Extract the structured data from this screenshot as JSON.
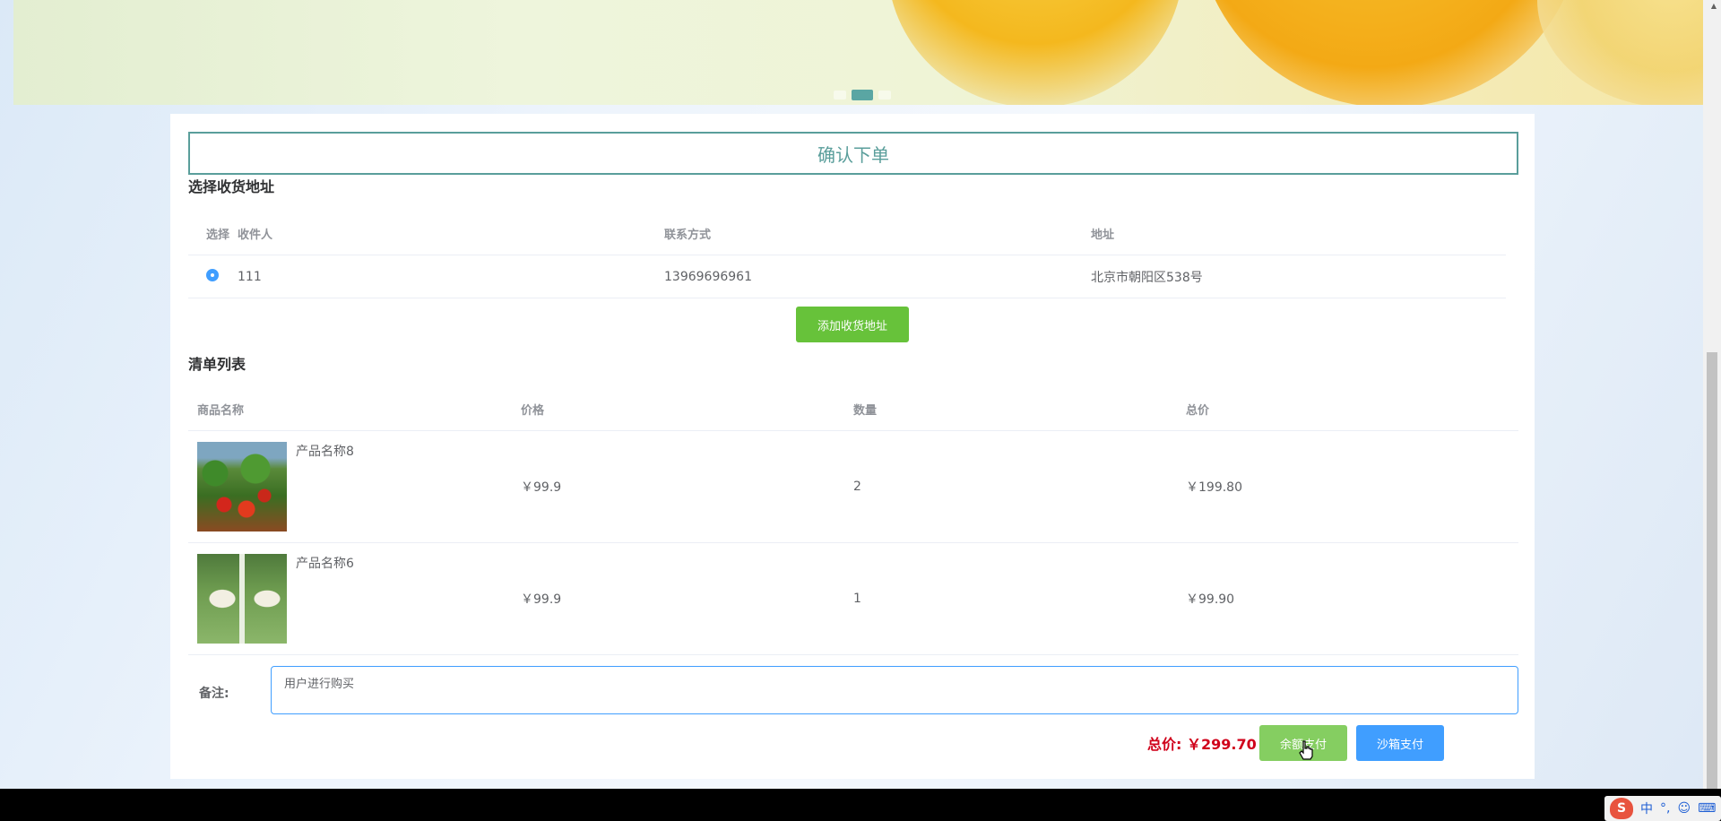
{
  "banner": {
    "slide_count": 3,
    "active_slide": 2
  },
  "confirm_title": "确认下单",
  "address_section": {
    "title": "选择收货地址",
    "headers": [
      "选择",
      "收件人",
      "联系方式",
      "地址"
    ],
    "rows": [
      {
        "selected": true,
        "name": "111",
        "phone": "13969696961",
        "address": "北京市朝阳区538号"
      }
    ],
    "add_button": "添加收货地址"
  },
  "goods_section": {
    "title": "清单列表",
    "headers": [
      "商品名称",
      "价格",
      "数量",
      "总价"
    ],
    "rows": [
      {
        "name": "产品名称8",
        "price": "￥99.9",
        "qty": "2",
        "total": "￥199.80",
        "image_icon": "vegetables-photo"
      },
      {
        "name": "产品名称6",
        "price": "￥99.9",
        "qty": "1",
        "total": "￥99.90",
        "image_icon": "rice-bag-photo"
      }
    ]
  },
  "remark": {
    "label": "备注:",
    "value": "用户进行购买"
  },
  "summary": {
    "total_label": "总价:",
    "total_value": "￥299.70"
  },
  "pay_buttons": {
    "balance": "余额支付",
    "sandbox": "沙箱支付"
  },
  "colors": {
    "accent": "#5a9e9b",
    "primary": "#409eff",
    "success": "#67c23a",
    "price_red": "#d0021b"
  },
  "ime": {
    "char": "中",
    "punct": "°,"
  }
}
